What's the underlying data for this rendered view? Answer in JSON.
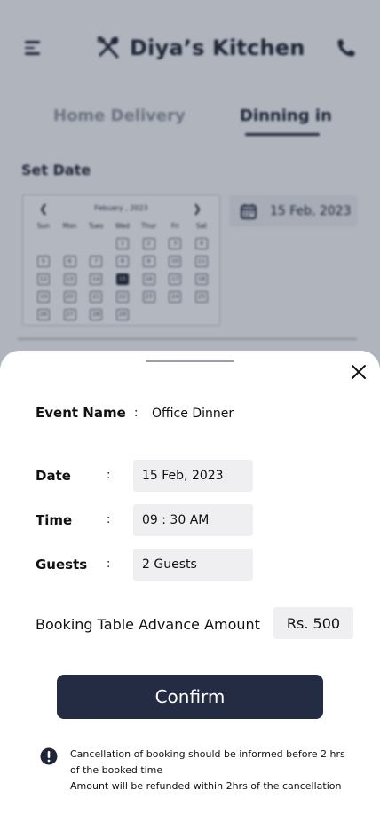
{
  "app": {
    "title": "Diya’s Kitchen"
  },
  "tabs": [
    {
      "label": "Home Delivery",
      "active": false
    },
    {
      "label": "Dinning in",
      "active": true
    }
  ],
  "set_date": {
    "label": "Set Date",
    "selected_display": "15 Feb, 2023"
  },
  "calendar": {
    "month_label": "Febuary ,  2023",
    "weekdays": [
      "Sun",
      "Mon",
      "Tues",
      "Wed",
      "Thur",
      "Fri",
      "Sat"
    ],
    "weeks": [
      [
        "",
        "",
        "",
        "1",
        "2",
        "3",
        "4"
      ],
      [
        "5",
        "6",
        "7",
        "8",
        "9",
        "10",
        "11"
      ],
      [
        "12",
        "13",
        "14",
        "15",
        "16",
        "17",
        "18"
      ],
      [
        "19",
        "20",
        "21",
        "22",
        "23",
        "24",
        "25"
      ],
      [
        "26",
        "27",
        "28",
        "29",
        "",
        "",
        ""
      ]
    ],
    "selected_day": "15"
  },
  "sheet": {
    "event_name_label": "Event Name",
    "event_name_value": "Office Dinner",
    "date_label": "Date",
    "date_value": "15 Feb, 2023",
    "time_label": "Time",
    "time_value": "09 : 30 AM",
    "guests_label": "Guests",
    "guests_value": "2 Guests",
    "colon": ":",
    "advance_label": "Booking Table Advance Amount",
    "advance_value": "Rs. 500",
    "confirm_label": "Confirm",
    "info_line1": "Cancellation of booking should be informed before 2 hrs of the booked time",
    "info_line2": "Amount will be refunded within 2hrs of the cancellation"
  },
  "colors": {
    "primary": "#232c42",
    "field_bg": "#efeff1",
    "muted_tab": "#8a909c"
  },
  "icons": {
    "menu": "hamburger-menu-icon",
    "brand": "fork-spoon-icon",
    "phone": "phone-icon",
    "calendar": "calendar-icon",
    "close": "close-icon",
    "info": "exclamation-circle-icon"
  }
}
